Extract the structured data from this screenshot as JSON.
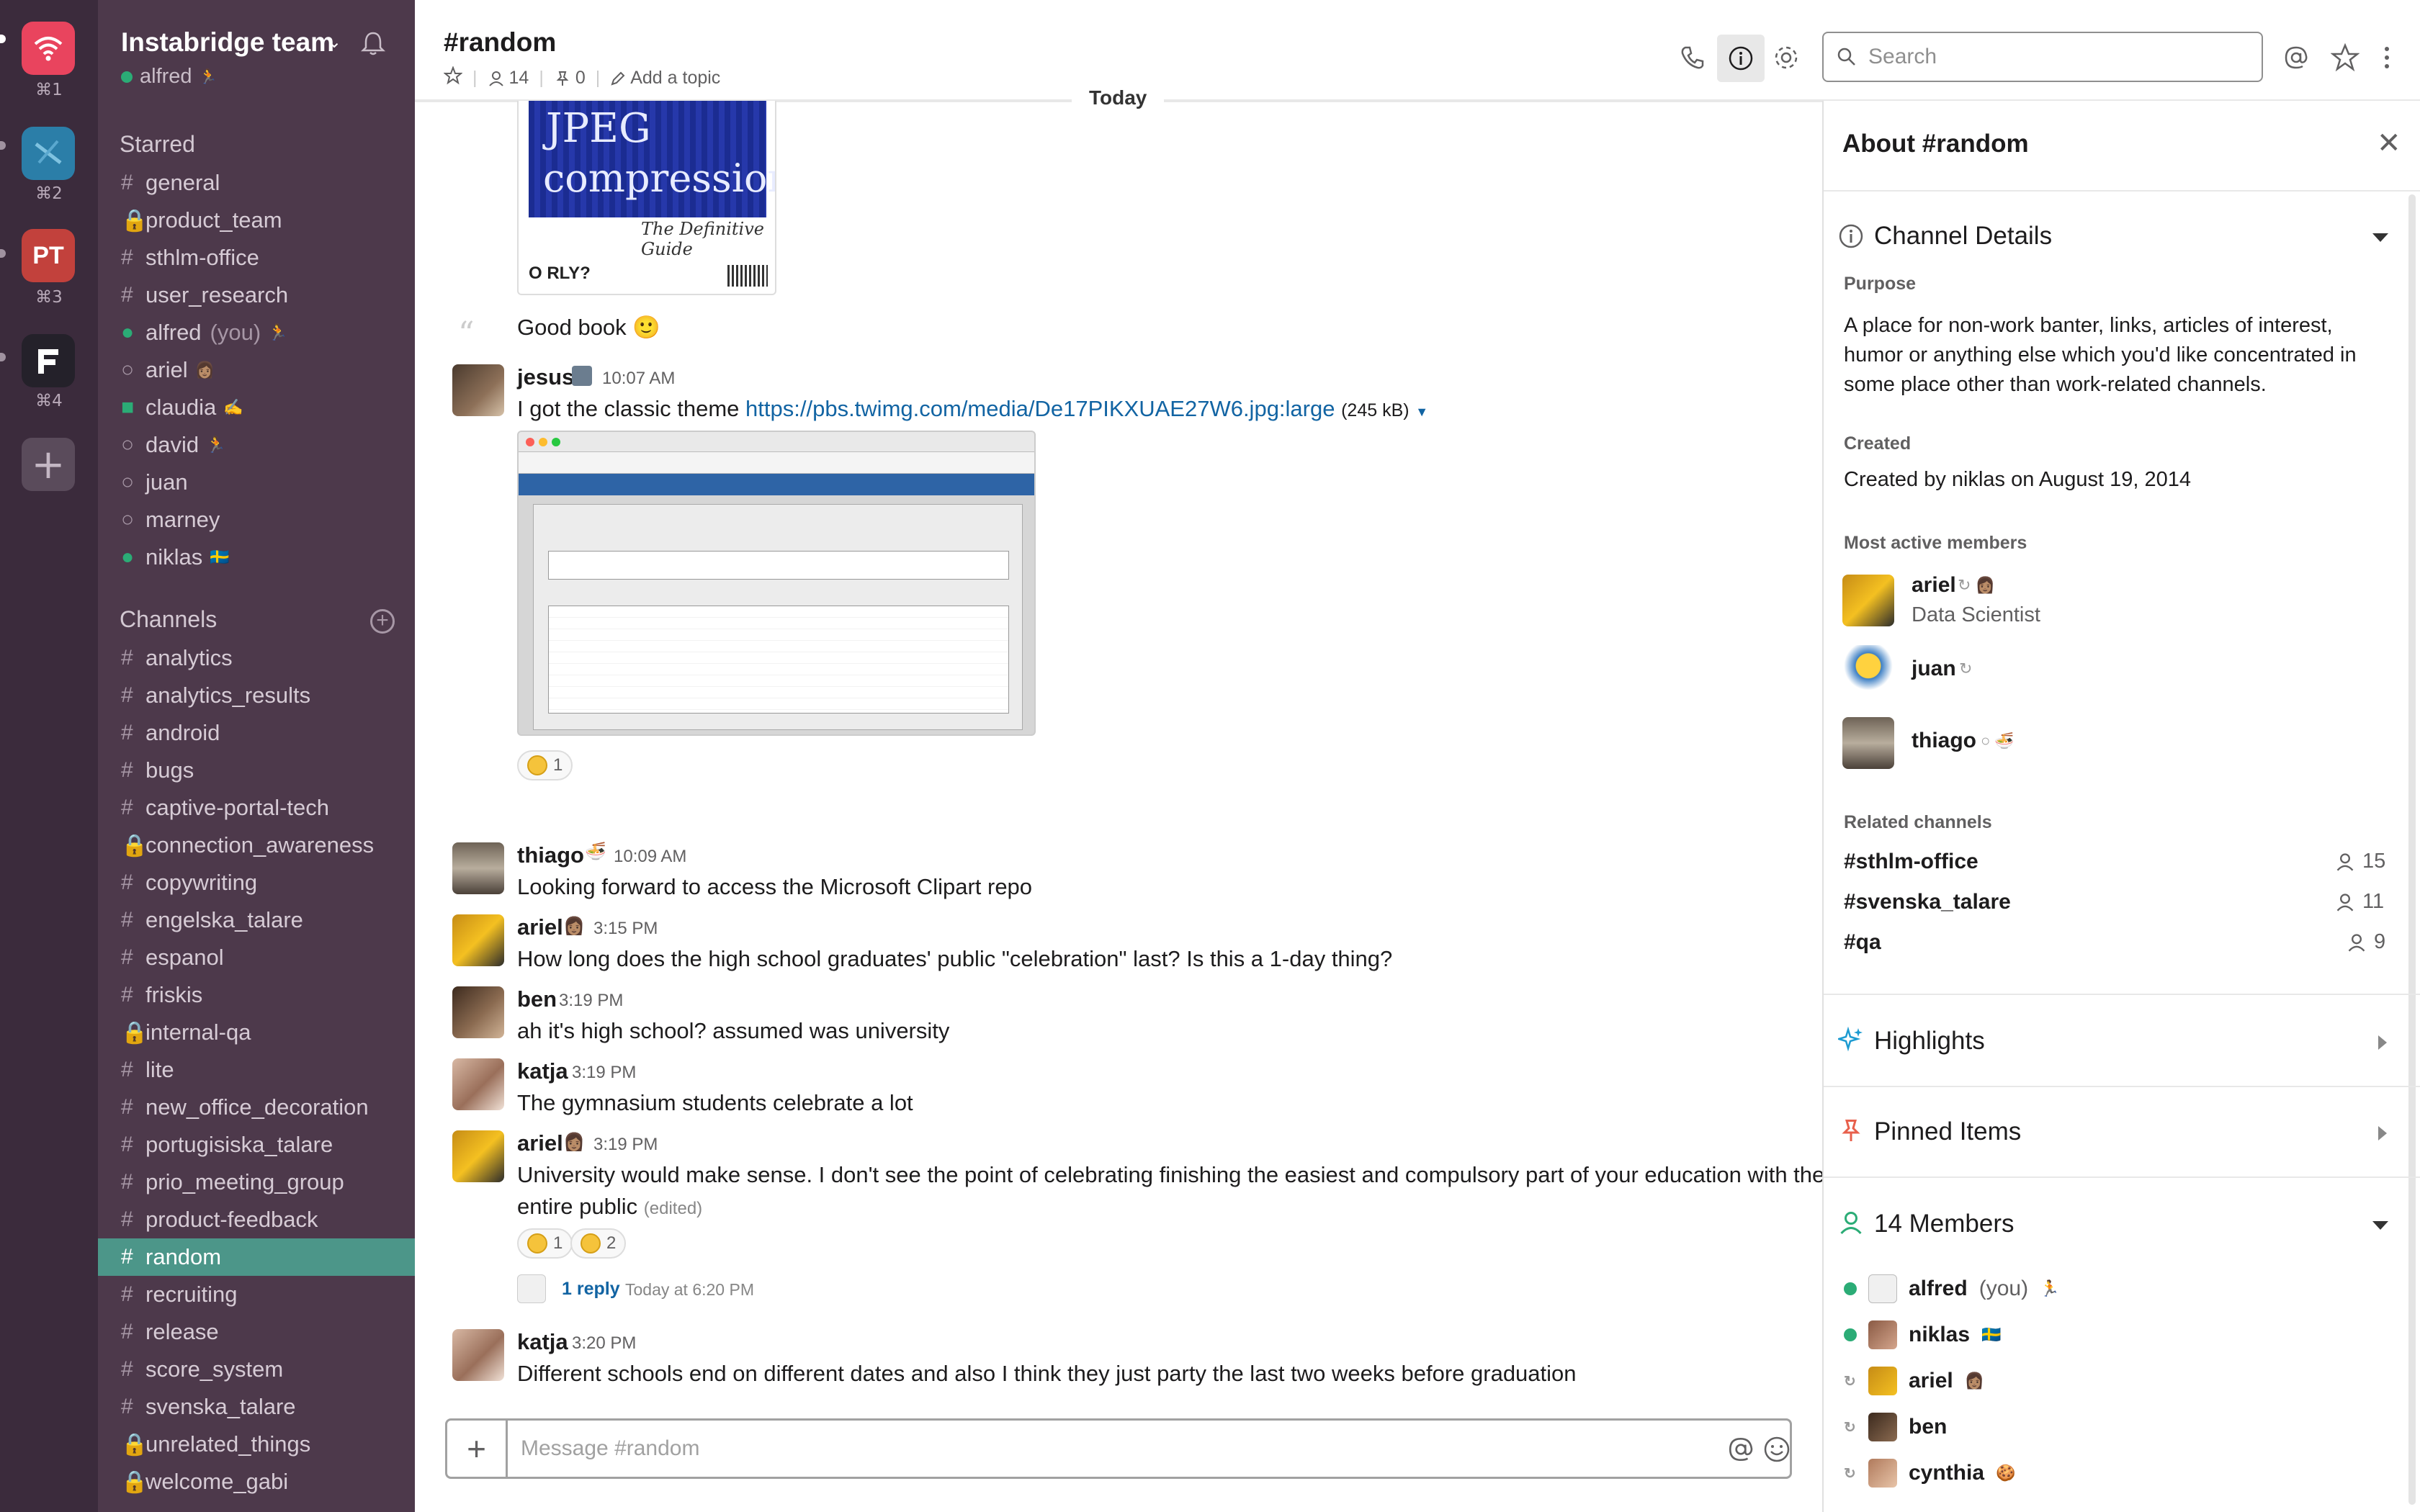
{
  "workspaces": [
    {
      "key": "⌘1",
      "initials": "",
      "color": "#e9445e",
      "icon": "wifi-icon"
    },
    {
      "key": "⌘2",
      "initials": "",
      "color": "#2b7ea8",
      "icon": "workspace-2-icon"
    },
    {
      "key": "⌘3",
      "initials": "PT",
      "color": "#c2413c",
      "icon": ""
    },
    {
      "key": "⌘4",
      "initials": "",
      "color": "#24212a",
      "icon": "workspace-4-icon"
    }
  ],
  "sidebar": {
    "team_name": "Instabridge team",
    "user": "alfred",
    "starred_heading": "Starred",
    "starred": [
      {
        "prefix": "#",
        "label": "general"
      },
      {
        "prefix": "🔒",
        "label": "product_team"
      },
      {
        "prefix": "#",
        "label": "sthlm-office"
      },
      {
        "prefix": "#",
        "label": "user_research"
      },
      {
        "prefix": "●",
        "label": "alfred",
        "suffix": "(you)",
        "emoji": "🏃"
      },
      {
        "prefix": "○",
        "label": "ariel",
        "emoji": "👩🏽"
      },
      {
        "prefix": "■",
        "label": "claudia",
        "emoji": "✍"
      },
      {
        "prefix": "○",
        "label": "david",
        "emoji": "🏃"
      },
      {
        "prefix": "○",
        "label": "juan"
      },
      {
        "prefix": "○",
        "label": "marney"
      },
      {
        "prefix": "●",
        "label": "niklas",
        "emoji": "🇸🇪"
      }
    ],
    "channels_heading": "Channels",
    "channels": [
      {
        "prefix": "#",
        "label": "analytics"
      },
      {
        "prefix": "#",
        "label": "analytics_results"
      },
      {
        "prefix": "#",
        "label": "android"
      },
      {
        "prefix": "#",
        "label": "bugs"
      },
      {
        "prefix": "#",
        "label": "captive-portal-tech"
      },
      {
        "prefix": "🔒",
        "label": "connection_awareness"
      },
      {
        "prefix": "#",
        "label": "copywriting"
      },
      {
        "prefix": "#",
        "label": "engelska_talare"
      },
      {
        "prefix": "#",
        "label": "espanol"
      },
      {
        "prefix": "#",
        "label": "friskis"
      },
      {
        "prefix": "🔒",
        "label": "internal-qa"
      },
      {
        "prefix": "#",
        "label": "lite"
      },
      {
        "prefix": "#",
        "label": "new_office_decoration"
      },
      {
        "prefix": "#",
        "label": "portugisiska_talare"
      },
      {
        "prefix": "#",
        "label": "prio_meeting_group"
      },
      {
        "prefix": "#",
        "label": "product-feedback"
      },
      {
        "prefix": "#",
        "label": "random",
        "active": true
      },
      {
        "prefix": "#",
        "label": "recruiting"
      },
      {
        "prefix": "#",
        "label": "release"
      },
      {
        "prefix": "#",
        "label": "score_system"
      },
      {
        "prefix": "#",
        "label": "svenska_talare"
      },
      {
        "prefix": "🔒",
        "label": "unrelated_things"
      },
      {
        "prefix": "🔒",
        "label": "welcome_gabi"
      }
    ]
  },
  "header": {
    "channel": "#random",
    "members_count": "14",
    "pins_count": "0",
    "add_topic": "Add a topic",
    "search_placeholder": "Search"
  },
  "messages": {
    "day_divider": "Today",
    "image_text_1": "JPEG",
    "image_text_2": "compression",
    "image_text_3": "The Definitive Guide",
    "image_text_4": "O RLY?",
    "quote_text": "Good book 🙂",
    "items": [
      {
        "author": "jesus",
        "time": "10:07 AM",
        "text_prefix": "I got the classic theme ",
        "link": "https://pbs.twimg.com/media/De17PIKXUAE27W6.jpg:large",
        "size": "(245 kB)",
        "reaction_count": "1"
      },
      {
        "author": "thiago",
        "time": "10:09 AM",
        "text": "Looking forward to access the Microsoft Clipart repo"
      },
      {
        "author": "ariel",
        "time": "3:15 PM",
        "text": "How long does the high school graduates' public \"celebration\" last? Is this a 1-day thing?"
      },
      {
        "author": "ben",
        "time": "3:19 PM",
        "text": "ah it's high school? assumed was university"
      },
      {
        "author": "katja",
        "time": "3:19 PM",
        "text": "The gymnasium students celebrate a lot"
      },
      {
        "author": "ariel",
        "time": "3:19 PM",
        "text": "University would make sense. I don't see the point of celebrating finishing the easiest and compulsory part of your education with the",
        "text2": "entire public",
        "edited": "(edited)",
        "reactions": [
          "1",
          "2"
        ],
        "replies": "1 reply",
        "reply_time": "Today at 6:20 PM"
      },
      {
        "author": "katja",
        "time": "3:20 PM",
        "text": "Different schools end on different dates and also I think they just party the last two weeks before graduation"
      }
    ]
  },
  "composer": {
    "placeholder": "Message #random"
  },
  "about": {
    "title": "About #random",
    "details_heading": "Channel Details",
    "purpose_label": "Purpose",
    "purpose_lines": [
      "A place for non-work banter, links, articles of interest,",
      "humor or anything else which you'd like concentrated in",
      "some place other than work-related channels."
    ],
    "created_label": "Created",
    "created_value": "Created by niklas on August 19, 2014",
    "active_label": "Most active members",
    "active_members": [
      {
        "name": "ariel",
        "title": "Data Scientist"
      },
      {
        "name": "juan",
        "title": ""
      },
      {
        "name": "thiago",
        "title": ""
      }
    ],
    "related_label": "Related channels",
    "related": [
      {
        "name": "#sthlm-office",
        "count": "15"
      },
      {
        "name": "#svenska_talare",
        "count": "11"
      },
      {
        "name": "#qa",
        "count": "9"
      }
    ],
    "highlights": "Highlights",
    "pinned": "Pinned Items",
    "members_heading": "14 Members",
    "members": [
      {
        "name": "alfred",
        "suffix": "(you)",
        "emoji": "🏃"
      },
      {
        "name": "niklas",
        "emoji": "🇸🇪"
      },
      {
        "name": "ariel",
        "emoji": "👩🏽"
      },
      {
        "name": "ben"
      },
      {
        "name": "cynthia",
        "emoji": "🍪"
      }
    ]
  },
  "colors": {
    "sidebar": "#4d394b",
    "rail": "#3b2b3c",
    "active": "#4c9689",
    "link": "#1264a3"
  }
}
